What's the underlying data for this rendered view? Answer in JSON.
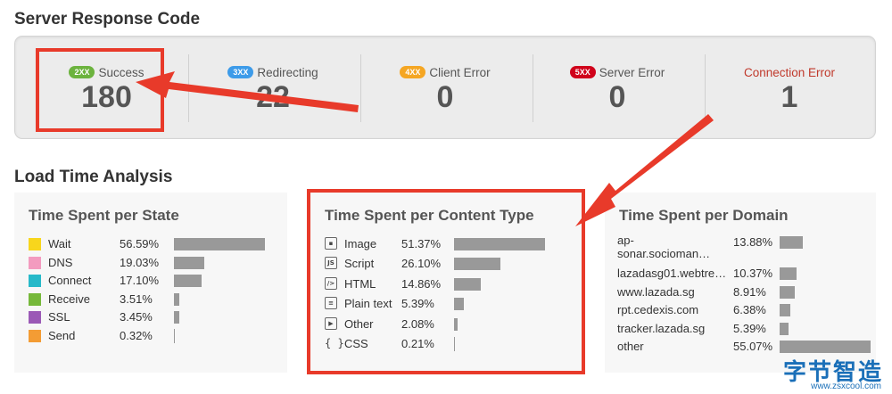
{
  "response_section": {
    "title": "Server Response Code",
    "codes": [
      {
        "badge": "2XX",
        "label": "Success",
        "value": "180",
        "color": "#6cb33e"
      },
      {
        "badge": "3XX",
        "label": "Redirecting",
        "value": "22",
        "color": "#3d9be9"
      },
      {
        "badge": "4XX",
        "label": "Client Error",
        "value": "0",
        "color": "#f5a623"
      },
      {
        "badge": "5XX",
        "label": "Server Error",
        "value": "0",
        "color": "#d0021b"
      },
      {
        "badge": "",
        "label": "Connection Error",
        "value": "1",
        "color": "#c0392b"
      }
    ]
  },
  "load_section": {
    "title": "Load Time Analysis",
    "per_state": {
      "title": "Time Spent per State",
      "rows": [
        {
          "name": "Wait",
          "pct": "56.59%",
          "value": 56.59,
          "color": "#f8d61c"
        },
        {
          "name": "DNS",
          "pct": "19.03%",
          "value": 19.03,
          "color": "#f39bbf"
        },
        {
          "name": "Connect",
          "pct": "17.10%",
          "value": 17.1,
          "color": "#27b9c9"
        },
        {
          "name": "Receive",
          "pct": "3.51%",
          "value": 3.51,
          "color": "#76b83a"
        },
        {
          "name": "SSL",
          "pct": "3.45%",
          "value": 3.45,
          "color": "#9b59b6"
        },
        {
          "name": "Send",
          "pct": "0.32%",
          "value": 0.32,
          "color": "#f39c34"
        }
      ]
    },
    "per_content": {
      "title": "Time Spent per Content Type",
      "rows": [
        {
          "name": "Image",
          "pct": "51.37%",
          "value": 51.37,
          "icon": "image-icon"
        },
        {
          "name": "Script",
          "pct": "26.10%",
          "value": 26.1,
          "icon": "script-icon"
        },
        {
          "name": "HTML",
          "pct": "14.86%",
          "value": 14.86,
          "icon": "html-icon"
        },
        {
          "name": "Plain text",
          "pct": "5.39%",
          "value": 5.39,
          "icon": "text-icon"
        },
        {
          "name": "Other",
          "pct": "2.08%",
          "value": 2.08,
          "icon": "other-icon"
        },
        {
          "name": "CSS",
          "pct": "0.21%",
          "value": 0.21,
          "icon": "css-icon"
        }
      ]
    },
    "per_domain": {
      "title": "Time Spent per Domain",
      "rows": [
        {
          "name": "ap-\nsonar.socioman…",
          "pct": "13.88%",
          "value": 13.88
        },
        {
          "name": "lazadasg01.webtre…",
          "pct": "10.37%",
          "value": 10.37
        },
        {
          "name": "www.lazada.sg",
          "pct": "8.91%",
          "value": 8.91
        },
        {
          "name": "rpt.cedexis.com",
          "pct": "6.38%",
          "value": 6.38
        },
        {
          "name": "tracker.lazada.sg",
          "pct": "5.39%",
          "value": 5.39
        },
        {
          "name": "other",
          "pct": "55.07%",
          "value": 55.07
        }
      ]
    }
  },
  "watermark": {
    "cn": "字节智造",
    "url": "www.zsxcool.com"
  },
  "accent_red": "#e83a2a"
}
